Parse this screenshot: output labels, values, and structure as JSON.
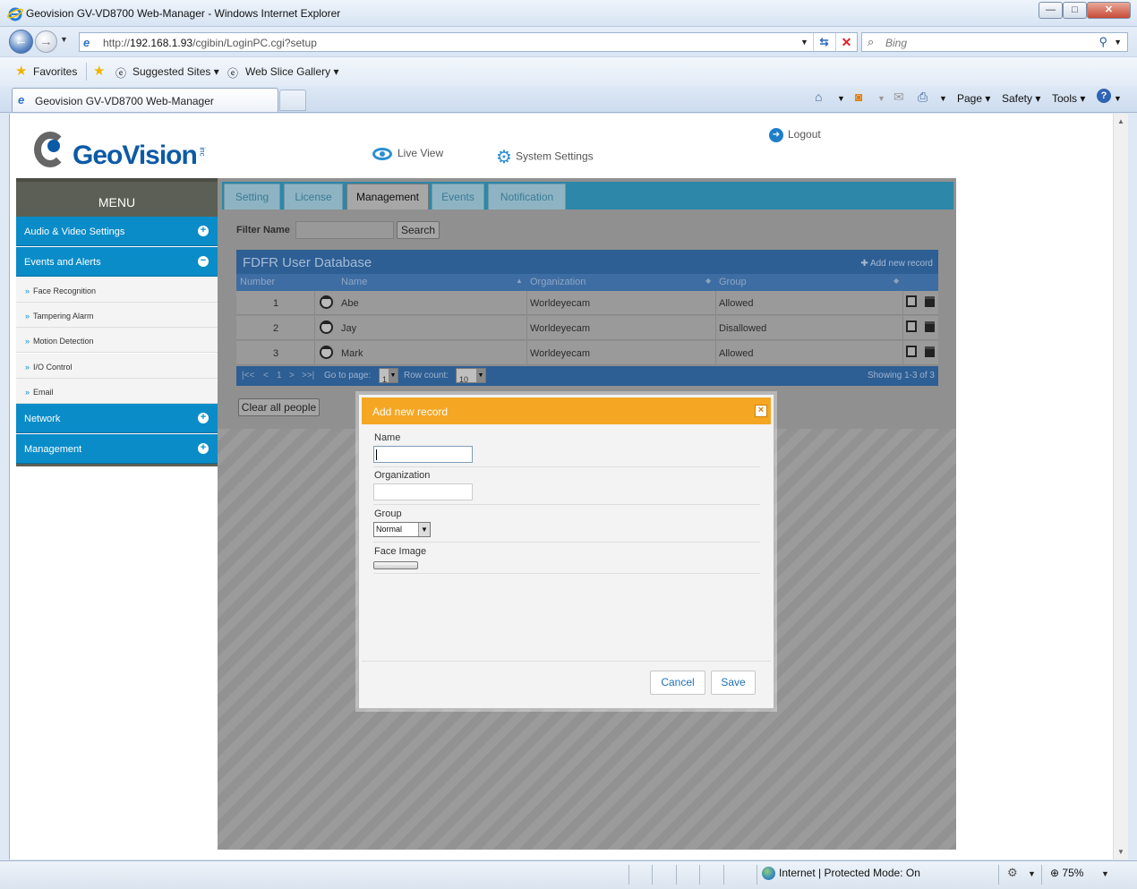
{
  "window": {
    "title": "Geovision GV-VD8700 Web-Manager - Windows Internet Explorer",
    "min_glyph": "—",
    "max_glyph": "□",
    "close_glyph": "✕"
  },
  "address": {
    "url_prefix": "http://",
    "url_host": "192.168.1.93",
    "url_path": "/cgibin/LoginPC.cgi?setup",
    "search_placeholder": "Bing"
  },
  "favorites": {
    "favorites_label": "Favorites",
    "suggested_label": "Suggested Sites",
    "webslice_label": "Web Slice Gallery"
  },
  "tabs": {
    "active_tab_label": "Geovision GV-VD8700 Web-Manager"
  },
  "commandbar": {
    "page_label": "Page",
    "safety_label": "Safety",
    "tools_label": "Tools"
  },
  "header": {
    "logo_text": "GeoVision",
    "logo_suffix": "inc",
    "live_view_label": "Live View",
    "system_settings_label": "System Settings",
    "logout_label": "Logout"
  },
  "sidebar": {
    "menu_title": "MENU",
    "sections": [
      {
        "label": "Audio & Video Settings",
        "toggle": "+"
      },
      {
        "label": "Events and Alerts",
        "toggle": "−"
      },
      {
        "label": "Network",
        "toggle": "+"
      },
      {
        "label": "Management",
        "toggle": "+"
      }
    ],
    "items": [
      {
        "label": "Face Recognition"
      },
      {
        "label": "Tampering Alarm"
      },
      {
        "label": "Motion Detection"
      },
      {
        "label": "I/O Control"
      },
      {
        "label": "Email"
      }
    ],
    "bullet": "»"
  },
  "main": {
    "tabs": [
      {
        "label": "Setting"
      },
      {
        "label": "License"
      },
      {
        "label": "Management"
      },
      {
        "label": "Events"
      },
      {
        "label": "Notification"
      }
    ],
    "active_tab": "Management",
    "filter_label": "Filter Name",
    "filter_value": "",
    "search_button": "Search",
    "clear_button": "Clear all people"
  },
  "grid": {
    "caption": "FDFR User Database",
    "add_label": "Add new record",
    "columns": [
      "Number",
      "Name",
      "Organization",
      "Group"
    ],
    "rows": [
      {
        "number": "1",
        "name": "Abe",
        "organization": "Worldeyecam",
        "group": "Allowed"
      },
      {
        "number": "2",
        "name": "Jay",
        "organization": "Worldeyecam",
        "group": "Disallowed"
      },
      {
        "number": "3",
        "name": "Mark",
        "organization": "Worldeyecam",
        "group": "Allowed"
      }
    ],
    "pager": {
      "nav_first": "|<<",
      "nav_prev": "<",
      "page_number": "1",
      "nav_next": ">",
      "nav_last": ">>|",
      "goto_label": "Go to page:",
      "goto_value": "1",
      "rowcount_label": "Row count:",
      "rowcount_value": "10",
      "showing": "Showing 1-3 of 3"
    }
  },
  "modal": {
    "title": "Add new record",
    "close_glyph": "×",
    "name_label": "Name",
    "name_value": "",
    "org_label": "Organization",
    "org_value": "",
    "group_label": "Group",
    "group_value": "Normal",
    "face_label": "Face Image",
    "cancel_label": "Cancel",
    "save_label": "Save"
  },
  "statusbar": {
    "zone_text": "Internet | Protected Mode: On",
    "zoom_text": "75%"
  },
  "colors": {
    "menu_blue": "#0a8cc8",
    "modal_orange": "#f5a623",
    "grid_blue": "#2d5e94",
    "brand_blue": "#0c5aa6"
  }
}
